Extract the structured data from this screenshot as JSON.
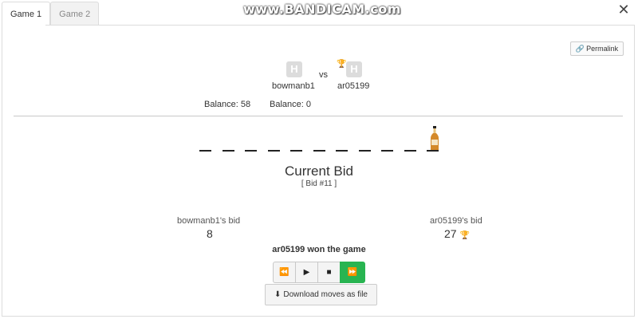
{
  "watermark": "www.BANDICAM.com",
  "tabs": [
    {
      "label": "Game 1",
      "active": true
    },
    {
      "label": "Game 2",
      "active": false
    }
  ],
  "permalink": {
    "label": "Permalink",
    "icon": "link-icon"
  },
  "players": {
    "left": {
      "name": "bowmanb1",
      "avatar_letter": "H",
      "balance": "Balance: 58",
      "bid_label": "bowmanb1's bid",
      "bid_value": "8"
    },
    "right": {
      "name": "ar05199",
      "avatar_letter": "H",
      "balance": "Balance: 0",
      "bid_label": "ar05199's bid",
      "bid_value": "27",
      "winner_icon": "trophy-icon"
    },
    "vs": "vs"
  },
  "board": {
    "slots": 11,
    "item_icon": "bottle-icon"
  },
  "current_bid": {
    "title": "Current Bid",
    "number": "[ Bid #11 ]"
  },
  "result": "ar05199 won the game",
  "controls": {
    "rewind": "⏪",
    "play": "▶",
    "stop": "■",
    "fast_forward": "⏩"
  },
  "download": {
    "label": "Download moves as file",
    "icon": "download-icon"
  },
  "colors": {
    "accent_green": "#28b451",
    "trophy": "#b8862b",
    "avatar_bg": "#dcdcdc"
  }
}
